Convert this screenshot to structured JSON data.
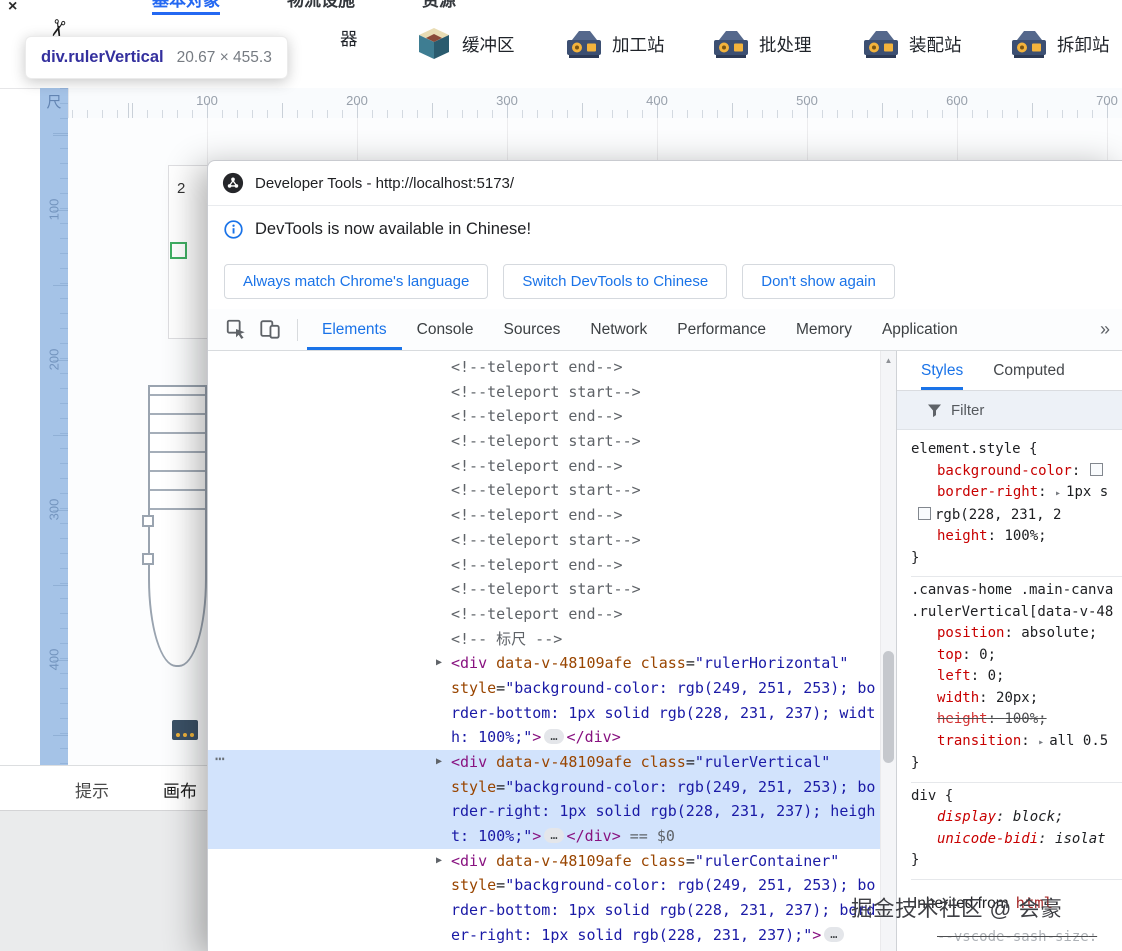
{
  "colors": {
    "accent_blue": "#1a73e8",
    "tab_underline_blue": "#2468f2",
    "dom_selection_bg": "#d2e3fc",
    "ruler_highlight": "rgba(96, 150, 214, 0.55)",
    "css_name_red": "#c80000"
  },
  "icons": {
    "scroll_up_glyph": "▲",
    "expand_glyph": "▶",
    "css_expand_glyph": "▸",
    "node_menu_glyph": "⋯"
  },
  "app": {
    "window_close_glyph": "×",
    "logo_glyph": "✂",
    "top_tabs": [
      {
        "label": "基本对象",
        "active": true
      },
      {
        "label": "物流设施",
        "active": false
      },
      {
        "label": "资源",
        "active": false
      }
    ],
    "stations": [
      {
        "label": "器",
        "icon": "none"
      },
      {
        "label": "缓冲区",
        "icon": "buffer"
      },
      {
        "label": "加工站",
        "icon": "machine"
      },
      {
        "label": "批处理",
        "icon": "machine"
      },
      {
        "label": "装配站",
        "icon": "machine"
      },
      {
        "label": "拆卸站",
        "icon": "machine"
      }
    ],
    "ruler": {
      "corner_glyph": "尺",
      "horizontal_numbers": [
        "100",
        "200",
        "300",
        "400",
        "500",
        "600",
        "700"
      ],
      "vertical_numbers": [
        "100",
        "200",
        "300",
        "400"
      ]
    },
    "canvas": {
      "count_label": "2"
    },
    "bottom_tabs": [
      {
        "label": "提示"
      },
      {
        "label": "画布"
      }
    ]
  },
  "inspect_tooltip": {
    "element": "div.rulerVertical",
    "dimensions": "20.67 × 455.3"
  },
  "devtools": {
    "title": "Developer Tools - http://localhost:5173/",
    "infobar": {
      "message": "DevTools is now available in Chinese!",
      "buttons": [
        {
          "label": "Always match Chrome's language"
        },
        {
          "label": "Switch DevTools to Chinese"
        },
        {
          "label": "Don't show again"
        }
      ]
    },
    "tabs": [
      {
        "label": "Elements",
        "active": true
      },
      {
        "label": "Console",
        "active": false
      },
      {
        "label": "Sources",
        "active": false
      },
      {
        "label": "Network",
        "active": false
      },
      {
        "label": "Performance",
        "active": false
      },
      {
        "label": "Memory",
        "active": false
      },
      {
        "label": "Application",
        "active": false
      }
    ],
    "more_tabs_glyph": "»",
    "dom_tree": {
      "lines": [
        {
          "seg": [
            [
              "c",
              "<!--teleport end-->"
            ]
          ]
        },
        {
          "seg": [
            [
              "c",
              "<!--teleport start-->"
            ]
          ]
        },
        {
          "seg": [
            [
              "c",
              "<!--teleport end-->"
            ]
          ]
        },
        {
          "seg": [
            [
              "c",
              "<!--teleport start-->"
            ]
          ]
        },
        {
          "seg": [
            [
              "c",
              "<!--teleport end-->"
            ]
          ]
        },
        {
          "seg": [
            [
              "c",
              "<!--teleport start-->"
            ]
          ]
        },
        {
          "seg": [
            [
              "c",
              "<!--teleport end-->"
            ]
          ]
        },
        {
          "seg": [
            [
              "c",
              "<!--teleport start-->"
            ]
          ]
        },
        {
          "seg": [
            [
              "c",
              "<!--teleport end-->"
            ]
          ]
        },
        {
          "seg": [
            [
              "c",
              "<!--teleport start-->"
            ]
          ]
        },
        {
          "seg": [
            [
              "c",
              "<!--teleport end-->"
            ]
          ]
        },
        {
          "seg": [
            [
              "c",
              "<!-- 标尺 -->"
            ]
          ]
        },
        {
          "arrow": true,
          "seg": [
            [
              "t",
              "<div"
            ],
            [
              "a",
              " data-v-48109afe "
            ],
            [
              "a",
              "class"
            ],
            [
              "p",
              "="
            ],
            [
              "v",
              "\"rulerHorizontal\""
            ]
          ]
        },
        {
          "seg": [
            [
              "a",
              "style"
            ],
            [
              "p",
              "="
            ],
            [
              "v",
              "\"background-color: rgb(249, 251, 253); bo"
            ]
          ]
        },
        {
          "seg": [
            [
              "v",
              "rder-bottom: 1px solid rgb(228, 231, 237); widt"
            ]
          ]
        },
        {
          "seg": [
            [
              "v",
              "h: 100%;\""
            ],
            [
              "t",
              ">"
            ],
            [
              "e",
              "…"
            ],
            [
              "t",
              "</div>"
            ]
          ]
        },
        {
          "sel": true,
          "gutter": "⋯",
          "arrow": true,
          "seg": [
            [
              "t",
              "<div"
            ],
            [
              "a",
              " data-v-48109afe "
            ],
            [
              "a",
              "class"
            ],
            [
              "p",
              "="
            ],
            [
              "v",
              "\"rulerVertical\""
            ]
          ]
        },
        {
          "sel": true,
          "seg": [
            [
              "a",
              "style"
            ],
            [
              "p",
              "="
            ],
            [
              "v",
              "\"background-color: rgb(249, 251, 253); bo"
            ]
          ]
        },
        {
          "sel": true,
          "seg": [
            [
              "v",
              "rder-right: 1px solid rgb(228, 231, 237); heigh"
            ]
          ]
        },
        {
          "sel": true,
          "seg": [
            [
              "v",
              "t: 100%;\""
            ],
            [
              "t",
              ">"
            ],
            [
              "e",
              "…"
            ],
            [
              "t",
              "</div>"
            ],
            [
              "d",
              " == $0"
            ]
          ]
        },
        {
          "arrow": true,
          "seg": [
            [
              "t",
              "<div"
            ],
            [
              "a",
              " data-v-48109afe "
            ],
            [
              "a",
              "class"
            ],
            [
              "p",
              "="
            ],
            [
              "v",
              "\"rulerContainer\""
            ]
          ]
        },
        {
          "seg": [
            [
              "a",
              "style"
            ],
            [
              "p",
              "="
            ],
            [
              "v",
              "\"background-color: rgb(249, 251, 253); bo"
            ]
          ]
        },
        {
          "seg": [
            [
              "v",
              "rder-bottom: 1px solid rgb(228, 231, 237); bord"
            ]
          ]
        },
        {
          "seg": [
            [
              "v",
              "er-right: 1px solid rgb(228, 231, 237);\""
            ],
            [
              "t",
              ">"
            ],
            [
              "e",
              "…"
            ]
          ]
        }
      ]
    },
    "styles_panel": {
      "tabs": [
        {
          "label": "Styles",
          "active": true
        },
        {
          "label": "Computed",
          "active": false
        }
      ],
      "filter_label": "Filter",
      "blocks": [
        {
          "type": "rule",
          "lines": [
            {
              "seg": [
                [
                  "sel",
                  "element.style"
                ],
                [
                  "p",
                  " {"
                ]
              ]
            },
            {
              "ind": 2,
              "seg": [
                [
                  "name",
                  "background-color"
                ],
                [
                  "p",
                  ": "
                ],
                [
                  "sw",
                  ""
                ]
              ]
            },
            {
              "ind": 2,
              "seg": [
                [
                  "name",
                  "border-right"
                ],
                [
                  "p",
                  ": "
                ],
                [
                  "ar",
                  "▸"
                ],
                [
                  "val",
                  "1px s"
                ]
              ]
            },
            {
              "ind": 1,
              "seg": [
                [
                  "sw",
                  ""
                ],
                [
                  "val",
                  "rgb(228, 231, 2"
                ]
              ]
            },
            {
              "ind": 2,
              "seg": [
                [
                  "name",
                  "height"
                ],
                [
                  "p",
                  ": "
                ],
                [
                  "val",
                  "100%;"
                ]
              ]
            },
            {
              "seg": [
                [
                  "p",
                  "}"
                ]
              ]
            }
          ]
        },
        {
          "type": "rule",
          "lines": [
            {
              "seg": [
                [
                  "sel",
                  ".canvas-home .main-canva"
                ]
              ]
            },
            {
              "seg": [
                [
                  "sel",
                  ".rulerVertical[data-v-48"
                ]
              ]
            },
            {
              "ind": 2,
              "seg": [
                [
                  "name",
                  "position"
                ],
                [
                  "p",
                  ": "
                ],
                [
                  "val",
                  "absolute;"
                ]
              ]
            },
            {
              "ind": 2,
              "seg": [
                [
                  "name",
                  "top"
                ],
                [
                  "p",
                  ": "
                ],
                [
                  "val",
                  "0;"
                ]
              ]
            },
            {
              "ind": 2,
              "seg": [
                [
                  "name",
                  "left"
                ],
                [
                  "p",
                  ": "
                ],
                [
                  "val",
                  "0;"
                ]
              ]
            },
            {
              "ind": 2,
              "seg": [
                [
                  "name",
                  "width"
                ],
                [
                  "p",
                  ": "
                ],
                [
                  "val",
                  "20px;"
                ]
              ]
            },
            {
              "ind": 2,
              "strike": true,
              "seg": [
                [
                  "name",
                  "height"
                ],
                [
                  "p",
                  ": "
                ],
                [
                  "val",
                  "100%;"
                ]
              ]
            },
            {
              "ind": 2,
              "seg": [
                [
                  "name",
                  "transition"
                ],
                [
                  "p",
                  ": "
                ],
                [
                  "ar",
                  "▸"
                ],
                [
                  "val",
                  "all 0.5"
                ]
              ]
            },
            {
              "seg": [
                [
                  "p",
                  "}"
                ]
              ]
            }
          ]
        },
        {
          "type": "rule",
          "lines": [
            {
              "seg": [
                [
                  "sel",
                  "div"
                ],
                [
                  "p",
                  " {"
                ]
              ]
            },
            {
              "ind": 2,
              "italic": true,
              "seg": [
                [
                  "name",
                  "display"
                ],
                [
                  "p",
                  ": "
                ],
                [
                  "val",
                  "block;"
                ]
              ]
            },
            {
              "ind": 2,
              "italic": true,
              "seg": [
                [
                  "name",
                  "unicode-bidi"
                ],
                [
                  "p",
                  ": "
                ],
                [
                  "val",
                  "isolat"
                ]
              ]
            },
            {
              "seg": [
                [
                  "p",
                  "}"
                ]
              ]
            }
          ]
        },
        {
          "type": "section",
          "label": "Inherited from",
          "node": "html"
        },
        {
          "type": "rule",
          "lines": [
            {
              "ind": 2,
              "strike": true,
              "dim": true,
              "seg": [
                [
                  "name",
                  "--vscode-sash-size"
                ],
                [
                  "p",
                  ":"
                ]
              ]
            }
          ]
        }
      ]
    }
  },
  "watermark": "掘金技术社区 @ 会豪"
}
